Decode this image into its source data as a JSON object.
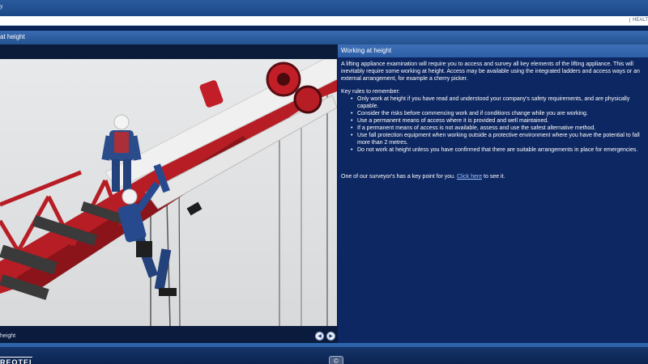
{
  "window": {
    "title": "y",
    "header_tag": "HEALT"
  },
  "module": {
    "title": "at height"
  },
  "media": {
    "caption": "height",
    "prev_label": "◀",
    "next_label": "▶"
  },
  "panel": {
    "heading": "Working at height",
    "intro": "A lifting appliance examination will require you to access and survey all key elements of the lifting appliance. This will inevitably require some working at height. Access may be available using the integrated ladders and access ways or an external arrangement, for example a cherry picker.",
    "rules_heading": "Key rules to remember:",
    "rules": [
      "Only work at height if you have read and understood your company's safety requirements, and are physically capable.",
      "Consider the risks before commencing work and if conditions change while you are working.",
      "Use a permanent means of access where it is provided and well maintained.",
      "If a permanent means of access is not available, assess and use the safest alternative method.",
      "Use fall protection equipment when working outside a protective environment where you have the potential to fall more than 2 metres.",
      "Do not work at height unless you have confirmed that there are suitable arrangements in place for emergencies."
    ],
    "key_point_before": "One of our surveyor's has a key point for you. ",
    "key_point_link": "Click here",
    "key_point_after": " to see it."
  },
  "footer": {
    "logo": "REOTEI",
    "center_button": "©"
  },
  "colors": {
    "background": "#0f2a5c",
    "panel": "#0d2762",
    "header": "#2b5ea6",
    "link": "#9fc2ff"
  },
  "icons": {
    "prev": "chevron-left-icon",
    "next": "chevron-right-icon",
    "footer": "replay-icon"
  }
}
